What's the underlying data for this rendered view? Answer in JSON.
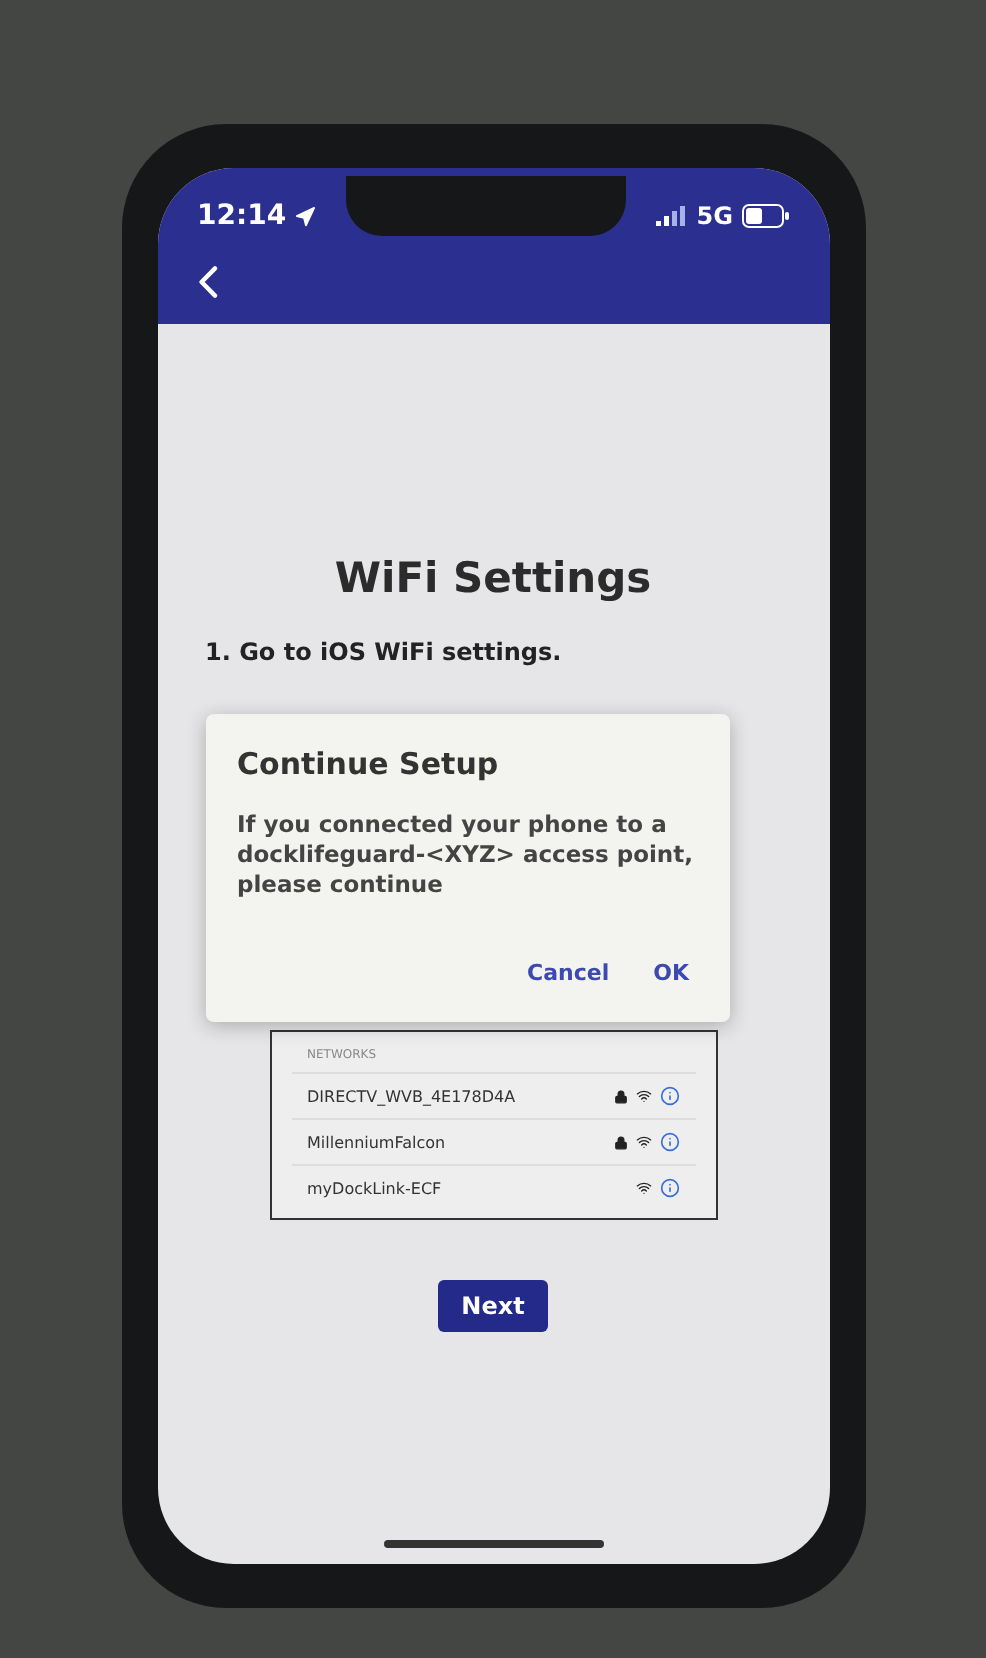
{
  "status_bar": {
    "time": "12:14",
    "network": "5G"
  },
  "title": "WiFi Settings",
  "steps": [
    "1. Go to iOS WiFi settings."
  ],
  "networks": {
    "header": "NETWORKS",
    "items": [
      {
        "name": "DIRECTV_WVB_4E178D4A",
        "locked": true
      },
      {
        "name": "MillenniumFalcon",
        "locked": true
      },
      {
        "name": "myDockLink-ECF",
        "locked": false
      }
    ]
  },
  "next_button": "Next",
  "dialog": {
    "title": "Continue Setup",
    "message": "If you connected your phone to a docklifeguard-<XYZ> access point, please continue",
    "buttons": [
      "Cancel",
      "OK"
    ]
  }
}
